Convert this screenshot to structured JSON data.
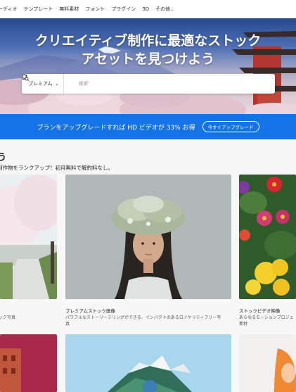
{
  "nav": {
    "items": [
      {
        "label": "ーディオ"
      },
      {
        "label": "テンプレート"
      },
      {
        "label": "無料素材"
      },
      {
        "label": "フォント"
      },
      {
        "label": "プラグイン"
      },
      {
        "label": "3D"
      },
      {
        "label": "その他"
      }
    ]
  },
  "hero": {
    "title_line1": "クリエイティブ制作に最適なストック",
    "title_line2": "アセットを見つけよう"
  },
  "search": {
    "scope_value": "プレミアム",
    "placeholder": "検索"
  },
  "banner": {
    "text": "プランをアップグレードすれば HD ビデオが 33% お得",
    "button_label": "今すぐアップグレード"
  },
  "section": {
    "title": "う",
    "subtitle": "制作物をランクアップ！初月無料で解約料なし。"
  },
  "cards": [
    {
      "title": "",
      "desc": "ック写真"
    },
    {
      "title": "プレミアムストック画像",
      "desc_line1": "パワフルなストーリーテリングができる、インパクトのあるロイヤリティフリー写",
      "desc_line2": "真"
    },
    {
      "title": "ストックビデオ映像",
      "desc_line1": "あらゆるモーションプロジェ",
      "desc_line2": "素材"
    }
  ],
  "colors": {
    "banner_bg": "#1473e6",
    "page_bg": "#f7f7f7"
  }
}
